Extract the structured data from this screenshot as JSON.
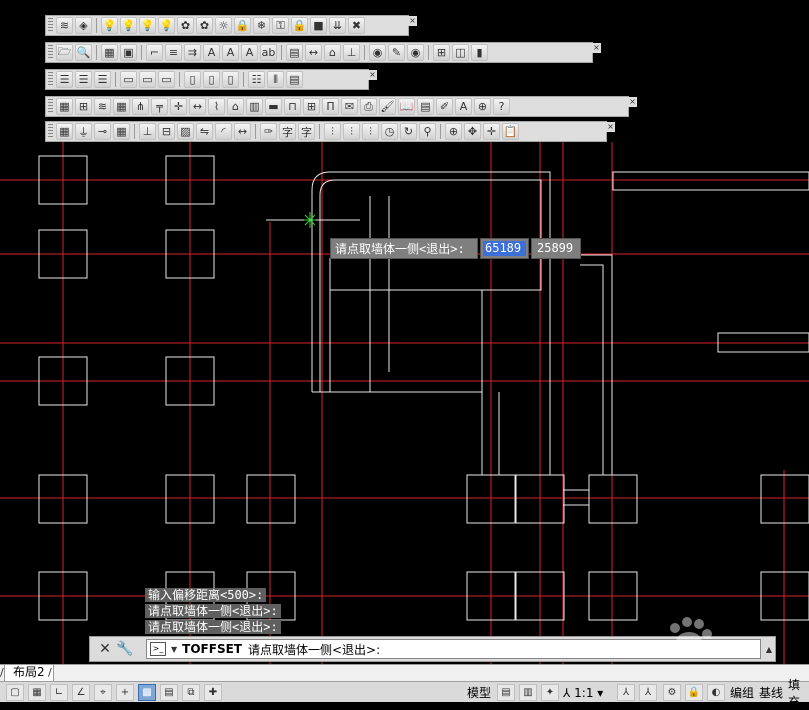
{
  "toolbars": [
    {
      "icons": [
        "layers-icon",
        "layer-states-icon",
        "sep",
        "lightbulb-on-icon",
        "lightbulb-locked-icon",
        "lightbulb-icon",
        "lightbulb-sun-icon",
        "gear-flower-icon",
        "gear-flower-alt-icon",
        "sun-icon",
        "sun-lock-icon",
        "freeze-icon",
        "key-icon",
        "lock-icon",
        "layer-down-icon",
        "layer-merge-icon",
        "layer-delete-icon"
      ]
    },
    {
      "icons": [
        "open-icon",
        "preview-icon",
        "sep",
        "grid-icon",
        "frame-icon",
        "sep",
        "polyline-icon",
        "multiline-icon",
        "offset-icon",
        "text-style-icon",
        "text-a-icon",
        "text-edit-icon",
        "spell-icon",
        "sep",
        "table-icon",
        "dim-icon",
        "area-icon",
        "elevation-icon",
        "sep",
        "eye-red-icon",
        "pencil-icon",
        "eye-icon",
        "sep",
        "window-icon",
        "view-icon",
        "chart-icon"
      ]
    },
    {
      "icons": [
        "align-left-icon",
        "align-center-icon",
        "align-right-icon",
        "sep",
        "row-left-icon",
        "row-center-icon",
        "row-right-icon",
        "sep",
        "col-left-icon",
        "col-center-icon",
        "col-right-icon",
        "sep",
        "list-icon",
        "bars-icon",
        "table-small-icon"
      ]
    },
    {
      "icons": [
        "axis-grid-icon",
        "axis-edit-icon",
        "layers-blue-icon",
        "grid-red-icon",
        "column-grid-icon",
        "beam-icon",
        "node-icon",
        "dim-line-icon",
        "stairs-icon",
        "shop-icon",
        "building-icon",
        "wall-icon",
        "door-icon",
        "window-icon-2",
        "frame-door-icon",
        "envelope-icon",
        "print-icon",
        "brush-icon",
        "book-icon",
        "panel-icon",
        "paint-icon",
        "text-a-icon-2",
        "target-icon",
        "help-icon"
      ]
    },
    {
      "icons": [
        "grid-red-icon-2",
        "ground-icon",
        "pin-icon",
        "grid-red-icon-3",
        "sep",
        "elevation-blue-icon",
        "split-icon",
        "hatch-icon",
        "mirror-icon",
        "arc-icon",
        "dim-icon-2",
        "sep",
        "brush-text-icon",
        "text-zi-icon",
        "text-zi-edit-icon",
        "sep",
        "spikes-icon",
        "spikes-icon-2",
        "spikes-icon-3",
        "clock-icon",
        "rotate-icon",
        "fan-icon",
        "sep",
        "zoom-icon",
        "move-icon",
        "pan-icon",
        "clipboard-icon"
      ]
    }
  ],
  "dynamic_input": {
    "prompt": "请点取墙体一侧<退出>:",
    "x_value": "65189",
    "y_value": "25899"
  },
  "command_history": [
    "输入偏移距离<500>:",
    "请点取墙体一侧<退出>:",
    "请点取墙体一侧<退出>:"
  ],
  "command_line": {
    "command": "TOFFSET",
    "prompt": "请点取墙体一侧<退出>:"
  },
  "layout_tabs": {
    "current": "布局2"
  },
  "status_bar": {
    "model_label": "模型",
    "scale_label": "1:1",
    "edit_label": "编组",
    "baseline_label": "基线",
    "fill_label": "填充"
  },
  "colors": {
    "background": "#000000",
    "axis_line": "#d8242c",
    "geometry": "#e8e8e8",
    "cursor": "#3cd23c"
  }
}
